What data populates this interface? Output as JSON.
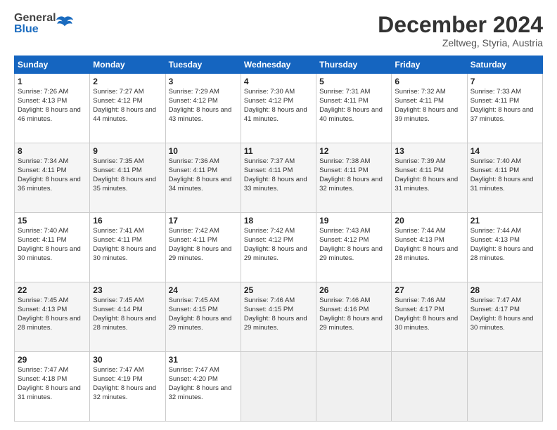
{
  "header": {
    "logo_line1": "General",
    "logo_line2": "Blue",
    "month": "December 2024",
    "location": "Zeltweg, Styria, Austria"
  },
  "days_of_week": [
    "Sunday",
    "Monday",
    "Tuesday",
    "Wednesday",
    "Thursday",
    "Friday",
    "Saturday"
  ],
  "weeks": [
    [
      {
        "day": "1",
        "sunrise": "7:26 AM",
        "sunset": "4:13 PM",
        "daylight": "8 hours and 46 minutes."
      },
      {
        "day": "2",
        "sunrise": "7:27 AM",
        "sunset": "4:12 PM",
        "daylight": "8 hours and 44 minutes."
      },
      {
        "day": "3",
        "sunrise": "7:29 AM",
        "sunset": "4:12 PM",
        "daylight": "8 hours and 43 minutes."
      },
      {
        "day": "4",
        "sunrise": "7:30 AM",
        "sunset": "4:12 PM",
        "daylight": "8 hours and 41 minutes."
      },
      {
        "day": "5",
        "sunrise": "7:31 AM",
        "sunset": "4:11 PM",
        "daylight": "8 hours and 40 minutes."
      },
      {
        "day": "6",
        "sunrise": "7:32 AM",
        "sunset": "4:11 PM",
        "daylight": "8 hours and 39 minutes."
      },
      {
        "day": "7",
        "sunrise": "7:33 AM",
        "sunset": "4:11 PM",
        "daylight": "8 hours and 37 minutes."
      }
    ],
    [
      {
        "day": "8",
        "sunrise": "7:34 AM",
        "sunset": "4:11 PM",
        "daylight": "8 hours and 36 minutes."
      },
      {
        "day": "9",
        "sunrise": "7:35 AM",
        "sunset": "4:11 PM",
        "daylight": "8 hours and 35 minutes."
      },
      {
        "day": "10",
        "sunrise": "7:36 AM",
        "sunset": "4:11 PM",
        "daylight": "8 hours and 34 minutes."
      },
      {
        "day": "11",
        "sunrise": "7:37 AM",
        "sunset": "4:11 PM",
        "daylight": "8 hours and 33 minutes."
      },
      {
        "day": "12",
        "sunrise": "7:38 AM",
        "sunset": "4:11 PM",
        "daylight": "8 hours and 32 minutes."
      },
      {
        "day": "13",
        "sunrise": "7:39 AM",
        "sunset": "4:11 PM",
        "daylight": "8 hours and 31 minutes."
      },
      {
        "day": "14",
        "sunrise": "7:40 AM",
        "sunset": "4:11 PM",
        "daylight": "8 hours and 31 minutes."
      }
    ],
    [
      {
        "day": "15",
        "sunrise": "7:40 AM",
        "sunset": "4:11 PM",
        "daylight": "8 hours and 30 minutes."
      },
      {
        "day": "16",
        "sunrise": "7:41 AM",
        "sunset": "4:11 PM",
        "daylight": "8 hours and 30 minutes."
      },
      {
        "day": "17",
        "sunrise": "7:42 AM",
        "sunset": "4:11 PM",
        "daylight": "8 hours and 29 minutes."
      },
      {
        "day": "18",
        "sunrise": "7:42 AM",
        "sunset": "4:12 PM",
        "daylight": "8 hours and 29 minutes."
      },
      {
        "day": "19",
        "sunrise": "7:43 AM",
        "sunset": "4:12 PM",
        "daylight": "8 hours and 29 minutes."
      },
      {
        "day": "20",
        "sunrise": "7:44 AM",
        "sunset": "4:13 PM",
        "daylight": "8 hours and 28 minutes."
      },
      {
        "day": "21",
        "sunrise": "7:44 AM",
        "sunset": "4:13 PM",
        "daylight": "8 hours and 28 minutes."
      }
    ],
    [
      {
        "day": "22",
        "sunrise": "7:45 AM",
        "sunset": "4:13 PM",
        "daylight": "8 hours and 28 minutes."
      },
      {
        "day": "23",
        "sunrise": "7:45 AM",
        "sunset": "4:14 PM",
        "daylight": "8 hours and 28 minutes."
      },
      {
        "day": "24",
        "sunrise": "7:45 AM",
        "sunset": "4:15 PM",
        "daylight": "8 hours and 29 minutes."
      },
      {
        "day": "25",
        "sunrise": "7:46 AM",
        "sunset": "4:15 PM",
        "daylight": "8 hours and 29 minutes."
      },
      {
        "day": "26",
        "sunrise": "7:46 AM",
        "sunset": "4:16 PM",
        "daylight": "8 hours and 29 minutes."
      },
      {
        "day": "27",
        "sunrise": "7:46 AM",
        "sunset": "4:17 PM",
        "daylight": "8 hours and 30 minutes."
      },
      {
        "day": "28",
        "sunrise": "7:47 AM",
        "sunset": "4:17 PM",
        "daylight": "8 hours and 30 minutes."
      }
    ],
    [
      {
        "day": "29",
        "sunrise": "7:47 AM",
        "sunset": "4:18 PM",
        "daylight": "8 hours and 31 minutes."
      },
      {
        "day": "30",
        "sunrise": "7:47 AM",
        "sunset": "4:19 PM",
        "daylight": "8 hours and 32 minutes."
      },
      {
        "day": "31",
        "sunrise": "7:47 AM",
        "sunset": "4:20 PM",
        "daylight": "8 hours and 32 minutes."
      },
      null,
      null,
      null,
      null
    ]
  ]
}
